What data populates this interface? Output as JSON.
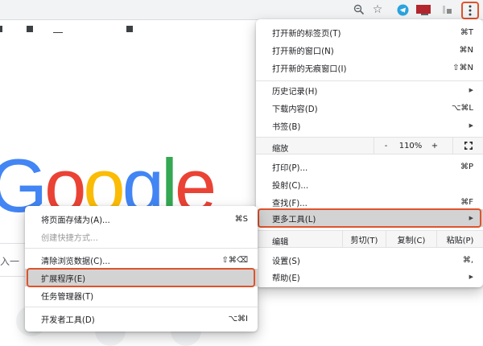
{
  "colors": {
    "accent_outline": "#e0532c",
    "google_blue": "#4285f4",
    "google_red": "#ea4335",
    "google_yellow": "#fbbc05",
    "google_green": "#34a853"
  },
  "toolbar": {
    "icons": [
      "zoom-icon",
      "star-icon",
      "telegram-icon",
      "extension-icon",
      "extension-icon",
      "menu-icon"
    ]
  },
  "page": {
    "logo": {
      "g": "G",
      "o1": "o",
      "o2": "o",
      "g2": "g",
      "l": "l",
      "e": "e"
    },
    "search_hint": "入一"
  },
  "main_menu": {
    "new_tab": {
      "label": "打开新的标签页(T)",
      "shortcut": "⌘T"
    },
    "new_window": {
      "label": "打开新的窗口(N)",
      "shortcut": "⌘N"
    },
    "new_incognito": {
      "label": "打开新的无痕窗口(I)",
      "shortcut": "⇧⌘N"
    },
    "history": {
      "label": "历史记录(H)"
    },
    "downloads": {
      "label": "下载内容(D)",
      "shortcut": "⌥⌘L"
    },
    "bookmarks": {
      "label": "书签(B)"
    },
    "zoom": {
      "label": "缩放",
      "minus": "-",
      "value": "110%",
      "plus": "+"
    },
    "print": {
      "label": "打印(P)...",
      "shortcut": "⌘P"
    },
    "cast": {
      "label": "投射(C)..."
    },
    "find": {
      "label": "查找(F)...",
      "shortcut": "⌘F"
    },
    "more_tools": {
      "label": "更多工具(L)"
    },
    "edit": {
      "label": "编辑",
      "cut": "剪切(T)",
      "copy": "复制(C)",
      "paste": "粘贴(P)"
    },
    "settings": {
      "label": "设置(S)",
      "shortcut": "⌘,"
    },
    "help": {
      "label": "帮助(E)"
    }
  },
  "sub_menu": {
    "save_page": {
      "label": "将页面存储为(A)...",
      "shortcut": "⌘S"
    },
    "create_shortcut": {
      "label": "创建快捷方式..."
    },
    "clear_data": {
      "label": "清除浏览数据(C)...",
      "shortcut": "⇧⌘⌫"
    },
    "extensions": {
      "label": "扩展程序(E)"
    },
    "task_manager": {
      "label": "任务管理器(T)"
    },
    "dev_tools": {
      "label": "开发者工具(D)",
      "shortcut": "⌥⌘I"
    }
  }
}
